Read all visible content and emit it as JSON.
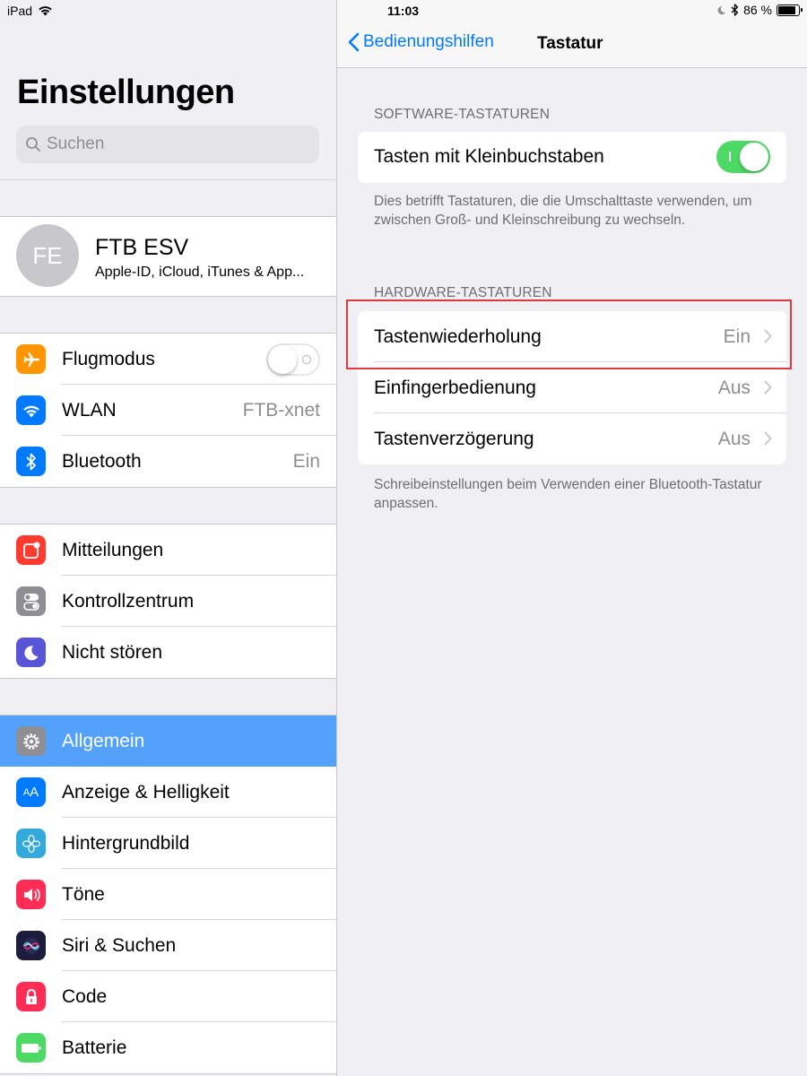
{
  "status": {
    "device": "iPad",
    "time": "11:03",
    "battery": "86 %"
  },
  "sidebar": {
    "title": "Einstellungen",
    "search_placeholder": "Suchen",
    "profile": {
      "initials": "FE",
      "name": "FTB ESV",
      "subtitle": "Apple-ID, iCloud, iTunes & App..."
    },
    "group1": [
      {
        "label": "Flugmodus",
        "icon": "airplane-icon",
        "color": "#ff9500",
        "toggle": "off"
      },
      {
        "label": "WLAN",
        "icon": "wifi-icon",
        "color": "#007aff",
        "value": "FTB-xnet"
      },
      {
        "label": "Bluetooth",
        "icon": "bluetooth-icon",
        "color": "#007aff",
        "value": "Ein"
      }
    ],
    "group2": [
      {
        "label": "Mitteilungen",
        "icon": "notifications-icon",
        "color": "#ff3b30"
      },
      {
        "label": "Kontrollzentrum",
        "icon": "control-center-icon",
        "color": "#8e8e93"
      },
      {
        "label": "Nicht stören",
        "icon": "moon-icon",
        "color": "#5856d6"
      }
    ],
    "group3": [
      {
        "label": "Allgemein",
        "icon": "gear-icon",
        "color": "#8e8e93",
        "active": true
      },
      {
        "label": "Anzeige & Helligkeit",
        "icon": "display-icon",
        "color": "#007aff"
      },
      {
        "label": "Hintergrundbild",
        "icon": "wallpaper-icon",
        "color": "#34aadc"
      },
      {
        "label": "Töne",
        "icon": "sound-icon",
        "color": "#ff2d55"
      },
      {
        "label": "Siri & Suchen",
        "icon": "siri-icon",
        "color": "#1c1c3c"
      },
      {
        "label": "Code",
        "icon": "lock-icon",
        "color": "#ff2d55"
      },
      {
        "label": "Batterie",
        "icon": "battery-icon",
        "color": "#4cd964"
      }
    ]
  },
  "detail": {
    "back_label": "Bedienungshilfen",
    "title": "Tastatur",
    "software_header": "SOFTWARE-TASTATUREN",
    "lowercase_label": "Tasten mit Kleinbuchstaben",
    "lowercase_toggle": "on",
    "software_footer": "Dies betrifft Tastaturen, die die Umschalttaste verwenden, um zwischen Groß- und Kleinschreibung zu wechseln.",
    "hardware_header": "HARDWARE-TASTATUREN",
    "hardware_rows": [
      {
        "label": "Tastenwiederholung",
        "value": "Ein"
      },
      {
        "label": "Einfingerbedienung",
        "value": "Aus"
      },
      {
        "label": "Tastenverzögerung",
        "value": "Aus"
      }
    ],
    "hardware_footer": "Schreibeinstellungen beim Verwenden einer Bluetooth-Tastatur anpassen.",
    "highlight_color": "#e0393e",
    "accent_color": "#007aff",
    "active_row_color": "#53a1fb"
  }
}
